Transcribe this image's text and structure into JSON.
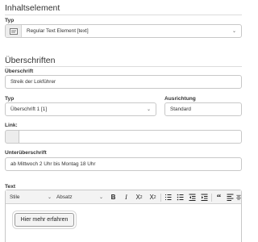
{
  "inhaltselement": {
    "heading": "Inhaltselement",
    "type_label": "Typ",
    "type_value": "Regular Text Element [text]"
  },
  "ueberschriften": {
    "heading": "Überschriften",
    "header_label": "Überschrift",
    "header_value": "Streik der Lokführer",
    "typ_label": "Typ",
    "typ_value": "Überschrift 1 [1]",
    "align_label": "Ausrichtung",
    "align_value": "Standard",
    "link_label": "Link:",
    "link_value": "",
    "subheader_label": "Unterüberschrift",
    "subheader_value": "ab Mittwoch 2 Uhr bis Montag 18 Uhr"
  },
  "text": {
    "label": "Text",
    "toolbar": {
      "style_select": "Stile",
      "format_select": "Absatz"
    },
    "content_button": "Hier mehr erfahren"
  },
  "icons": {
    "type_icon": "text-element-icon",
    "link_icon": "link-placeholder-icon",
    "dropdown": "chevron-down-icon"
  }
}
